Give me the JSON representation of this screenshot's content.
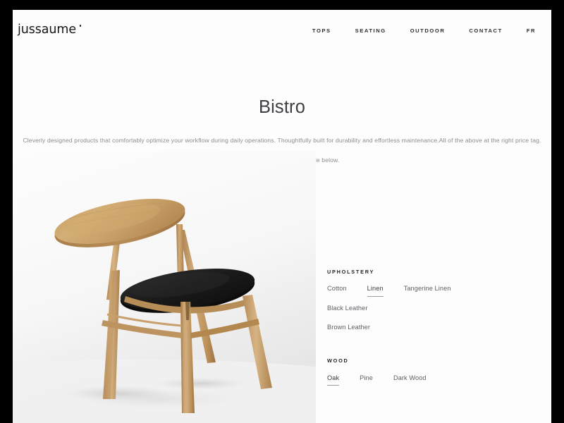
{
  "theme": {
    "frame_color": "#000000",
    "page_background": "#fdfdfd",
    "text_primary": "#1f2124",
    "text_muted": "#8a8d91",
    "accent_underline": "#9a9ca0",
    "wood_color": "#c19a62",
    "upholstery_color": "#1d1d1d"
  },
  "header": {
    "logo_text": "jussaume",
    "logo_mark": "registered-dot",
    "nav": [
      {
        "label": "TOPS",
        "name": "nav-item-tops"
      },
      {
        "label": "SEATING",
        "name": "nav-item-seating"
      },
      {
        "label": "OUTDOOR",
        "name": "nav-item-outdoor"
      },
      {
        "label": "CONTACT",
        "name": "nav-item-contact"
      },
      {
        "label": "FR",
        "name": "nav-item-language-fr"
      }
    ]
  },
  "hero": {
    "title": "Bistro",
    "paragraph_1": "Cleverly designed products that comfortably optimize your workflow during daily operations. Thoughtfully built for durability and effortless maintenance.All of the above at the right price tag.",
    "paragraph_2": "Have fun customizing the example below."
  },
  "product": {
    "image_alt": "oak-dining-chair-with-black-upholstered-seat"
  },
  "options": {
    "upholstery": {
      "label": "UPHOLSTERY",
      "selected": "Linen",
      "items": [
        {
          "label": "Cotton",
          "selected": false
        },
        {
          "label": "Linen",
          "selected": true
        },
        {
          "label": "Tangerine Linen",
          "selected": false
        },
        {
          "label": "Black Leather",
          "selected": false
        },
        {
          "label": "Brown Leather",
          "selected": false
        }
      ]
    },
    "wood": {
      "label": "WOOD",
      "selected": "Oak",
      "items": [
        {
          "label": "Oak",
          "selected": true
        },
        {
          "label": "Pine",
          "selected": false
        },
        {
          "label": "Dark Wood",
          "selected": false
        }
      ]
    }
  }
}
